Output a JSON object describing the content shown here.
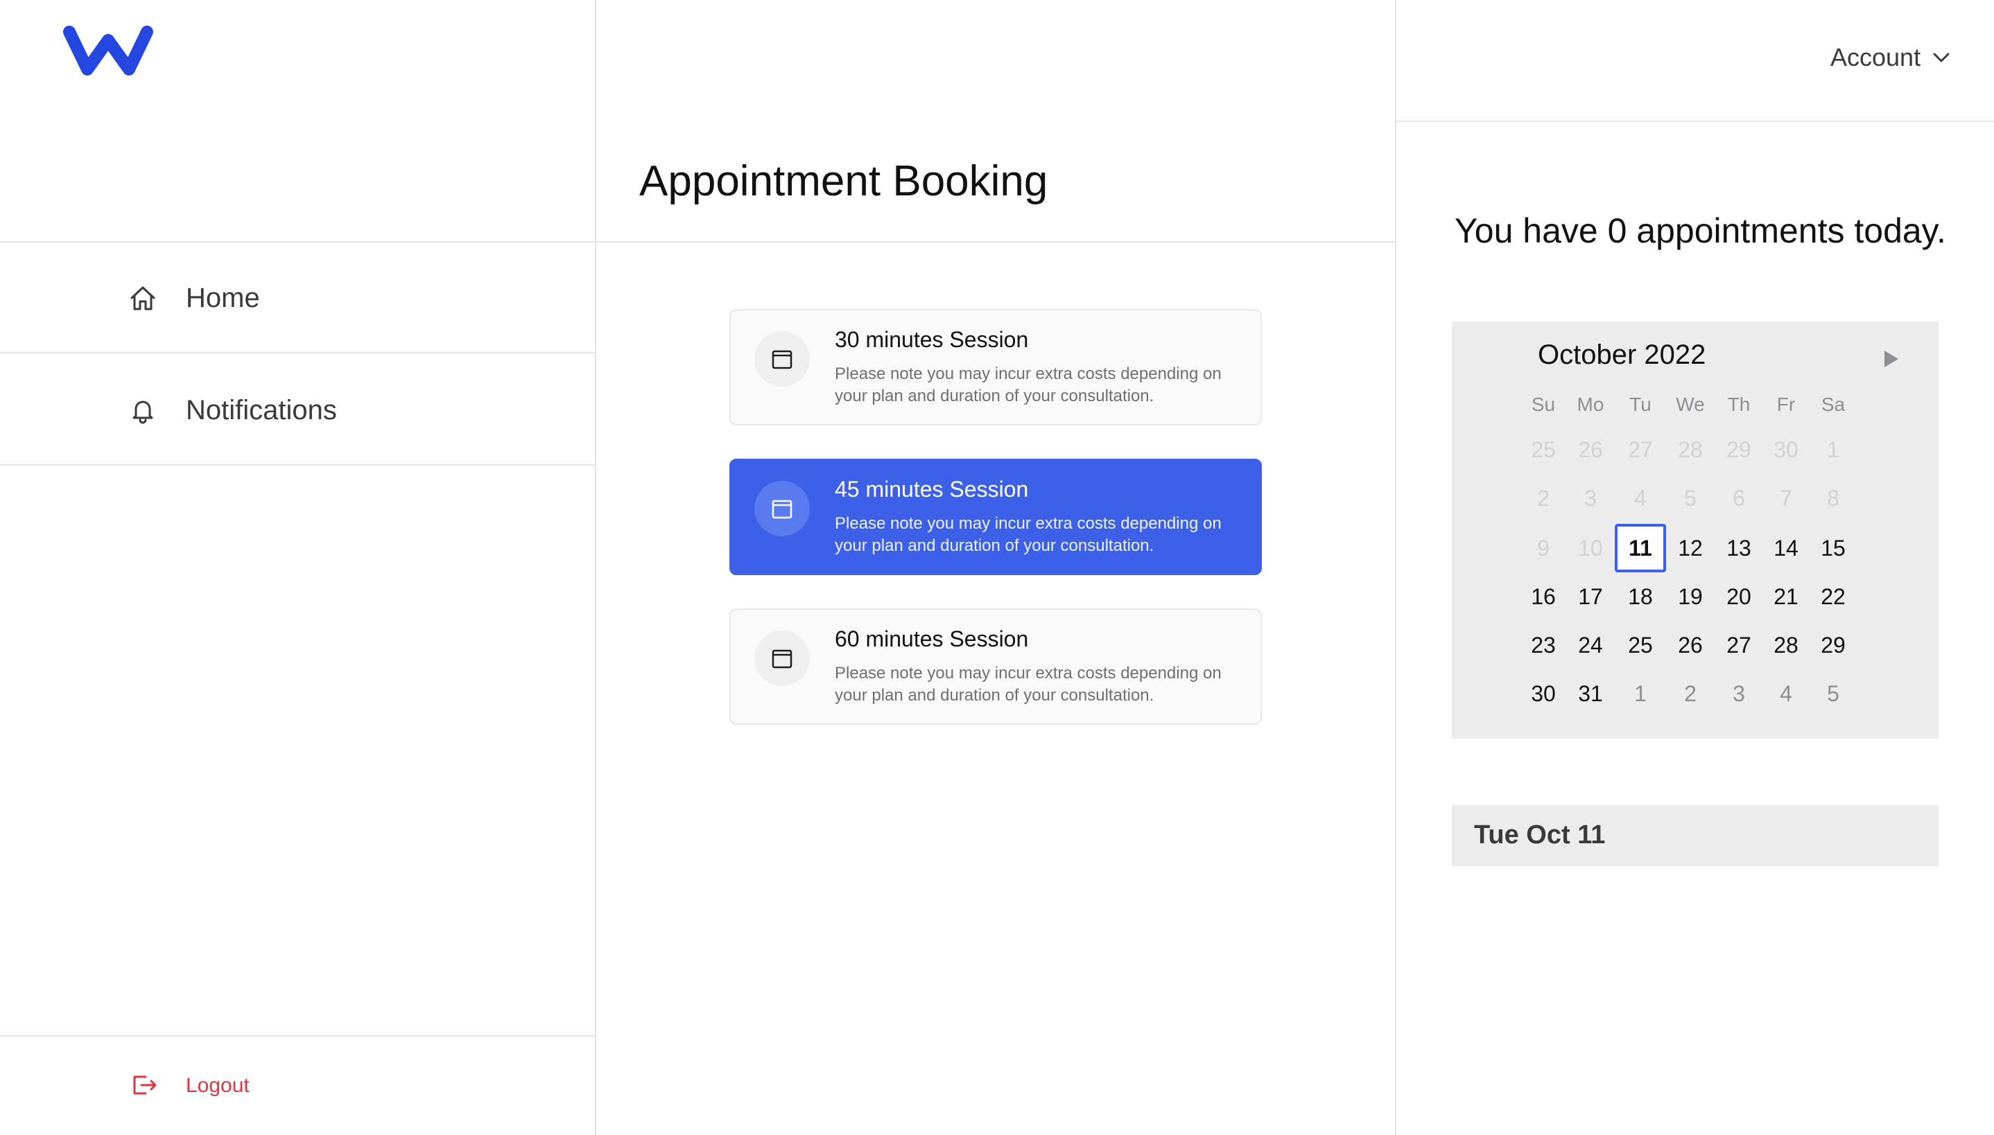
{
  "brand": {
    "logo_letter": "W",
    "accent": "#3c61e8"
  },
  "sidebar": {
    "items": [
      {
        "label": "Home",
        "icon": "home-icon"
      },
      {
        "label": "Notifications",
        "icon": "bell-icon"
      }
    ],
    "logout_label": "Logout"
  },
  "main": {
    "title": "Appointment Booking",
    "sessions": [
      {
        "title": "30 minutes Session",
        "desc": "Please note you may incur extra costs depending on your plan and duration of your consultation.",
        "selected": false
      },
      {
        "title": "45 minutes Session",
        "desc": "Please note you may incur extra costs depending on your plan and duration of your consultation.",
        "selected": true
      },
      {
        "title": "60 minutes Session",
        "desc": "Please note you may incur extra costs depending on your plan and duration of your consultation.",
        "selected": false
      }
    ]
  },
  "header": {
    "account_label": "Account"
  },
  "right": {
    "today_message": "You have 0 appointments today.",
    "calendar": {
      "month_label": "October 2022",
      "weekdays": [
        "Su",
        "Mo",
        "Tu",
        "We",
        "Th",
        "Fr",
        "Sa"
      ],
      "weeks": [
        [
          "25",
          "26",
          "27",
          "28",
          "29",
          "30",
          "1"
        ],
        [
          "2",
          "3",
          "4",
          "5",
          "6",
          "7",
          "8"
        ],
        [
          "9",
          "10",
          "11",
          "12",
          "13",
          "14",
          "15"
        ],
        [
          "16",
          "17",
          "18",
          "19",
          "20",
          "21",
          "22"
        ],
        [
          "23",
          "24",
          "25",
          "26",
          "27",
          "28",
          "29"
        ],
        [
          "30",
          "31",
          "1",
          "2",
          "3",
          "4",
          "5"
        ]
      ],
      "selected_day": "11"
    },
    "selected_date_label": "Tue Oct 11"
  }
}
